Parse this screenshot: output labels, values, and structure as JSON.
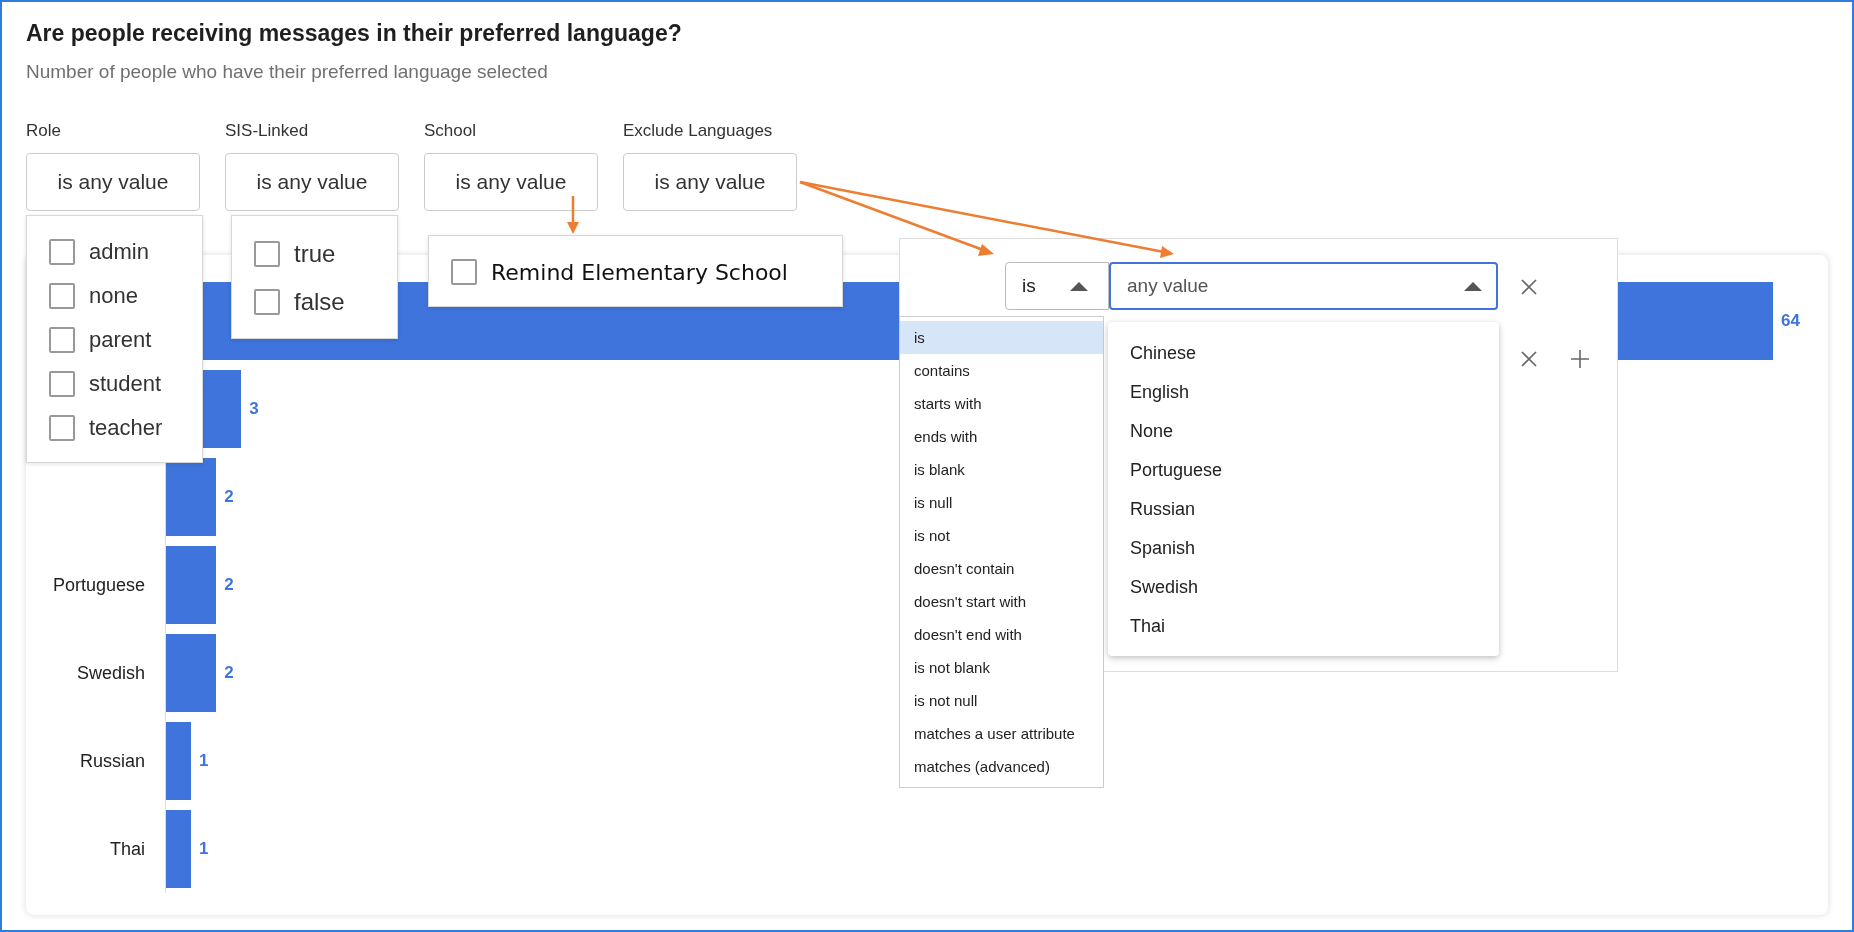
{
  "title": "Are people receiving messages in their preferred language?",
  "subtitle": "Number of people who have their preferred language selected",
  "filters": [
    {
      "label": "Role",
      "value": "is any value",
      "kind": "checklist",
      "options": [
        {
          "label": "admin",
          "checked": false
        },
        {
          "label": "none",
          "checked": false
        },
        {
          "label": "parent",
          "checked": false
        },
        {
          "label": "student",
          "checked": false
        },
        {
          "label": "teacher",
          "checked": false
        }
      ]
    },
    {
      "label": "SIS-Linked",
      "value": "is any value",
      "kind": "checklist",
      "options": [
        {
          "label": "true",
          "checked": false
        },
        {
          "label": "false",
          "checked": false
        }
      ]
    },
    {
      "label": "School",
      "value": "is any value",
      "kind": "checklist",
      "options": [
        {
          "label": "Remind Elementary School",
          "checked": false
        }
      ]
    },
    {
      "label": "Exclude Languages",
      "value": "is any value",
      "kind": "condition"
    }
  ],
  "condition_editor": {
    "operator": "is",
    "value_placeholder": "any value",
    "operator_options": [
      {
        "label": "is",
        "selected": true
      },
      {
        "label": "contains",
        "selected": false
      },
      {
        "label": "starts with",
        "selected": false
      },
      {
        "label": "ends with",
        "selected": false
      },
      {
        "label": "is blank",
        "selected": false
      },
      {
        "label": "is null",
        "selected": false
      },
      {
        "label": "is not",
        "selected": false
      },
      {
        "label": "doesn't contain",
        "selected": false
      },
      {
        "label": "doesn't start with",
        "selected": false
      },
      {
        "label": "doesn't end with",
        "selected": false
      },
      {
        "label": "is not blank",
        "selected": false
      },
      {
        "label": "is not null",
        "selected": false
      },
      {
        "label": "matches a user attribute",
        "selected": false
      },
      {
        "label": "matches (advanced)",
        "selected": false
      }
    ],
    "value_options": [
      "Chinese",
      "English",
      "None",
      "Portuguese",
      "Russian",
      "Spanish",
      "Swedish",
      "Thai"
    ]
  },
  "chart_data": {
    "type": "bar",
    "orientation": "horizontal",
    "categories": [
      null,
      null,
      null,
      "Portuguese",
      "Swedish",
      "Russian",
      "Thai"
    ],
    "values": [
      64,
      3,
      2,
      2,
      2,
      1,
      1
    ],
    "data_labels": true
  }
}
